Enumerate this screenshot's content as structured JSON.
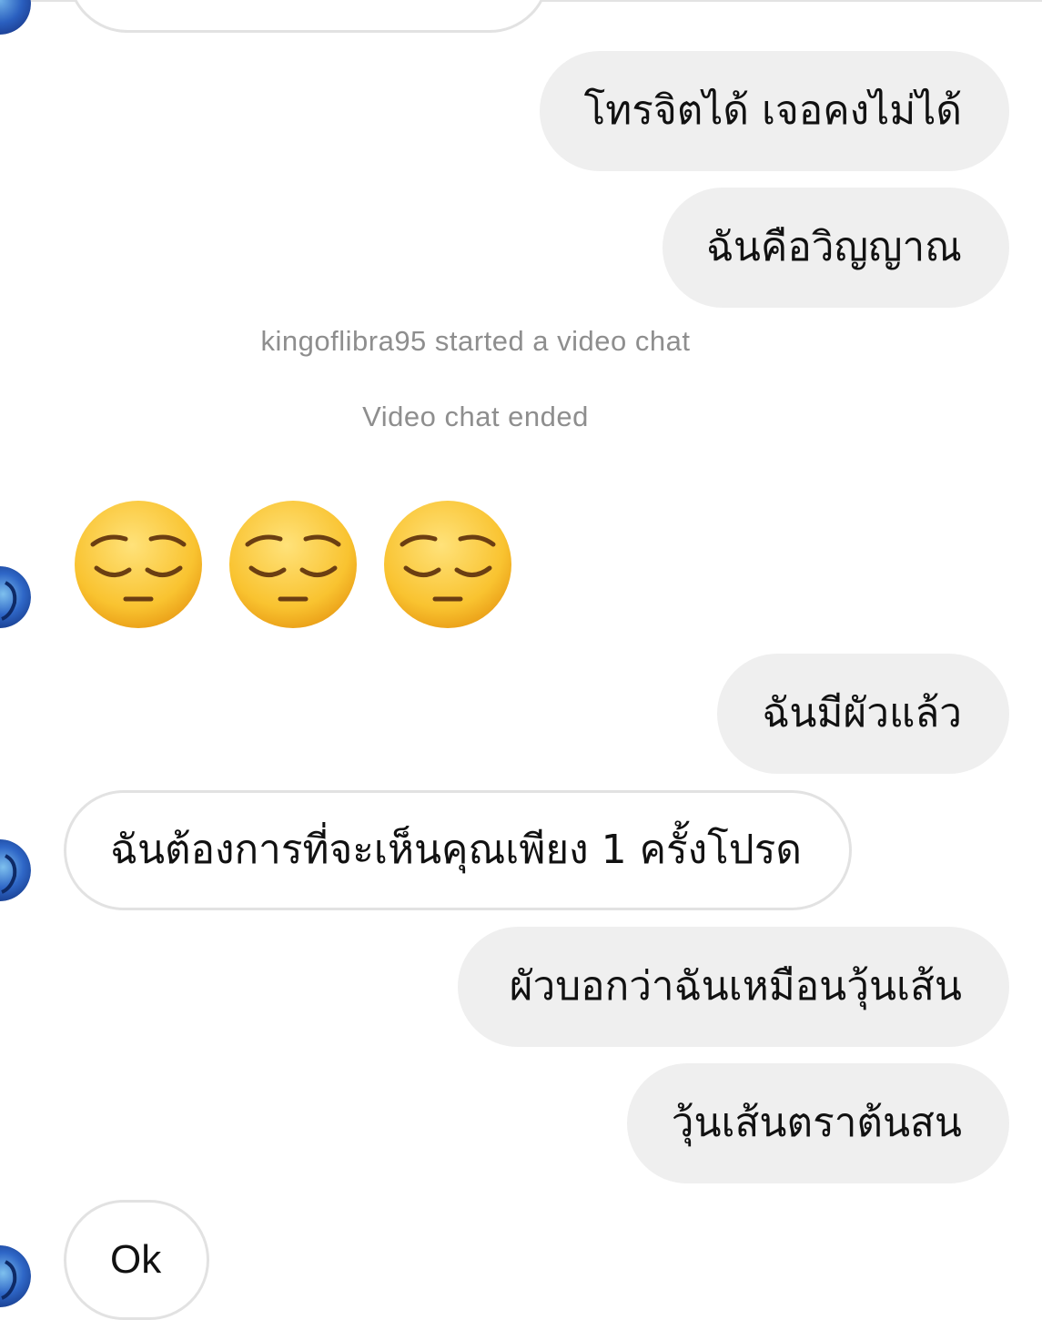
{
  "conversation": {
    "messages": [
      {
        "type": "outgoing",
        "text": "โทรจิตได้ เจอคงไม่ได้"
      },
      {
        "type": "outgoing",
        "text": "ฉันคือวิญญาณ"
      },
      {
        "type": "system",
        "text": "kingoflibra95 started a video chat"
      },
      {
        "type": "system",
        "text": "Video chat ended"
      },
      {
        "type": "incoming-emoji",
        "emojis": [
          "pensive-face-emoji",
          "pensive-face-emoji",
          "pensive-face-emoji"
        ]
      },
      {
        "type": "outgoing",
        "text": "ฉันมีผัวแล้ว"
      },
      {
        "type": "incoming",
        "text": "ฉันต้องการที่จะเห็นคุณเพียง 1 ครั้งโปรด"
      },
      {
        "type": "outgoing",
        "text": "ผัวบอกว่าฉันเหมือนวุ้นเส้น"
      },
      {
        "type": "outgoing",
        "text": "วุ้นเส้นตราต้นสน"
      },
      {
        "type": "incoming",
        "text": "Ok"
      }
    ]
  },
  "colors": {
    "outgoing_bubble": "#efefef",
    "incoming_border": "#e2e2e2",
    "system_text": "#8e8e8e",
    "text": "#111111"
  }
}
